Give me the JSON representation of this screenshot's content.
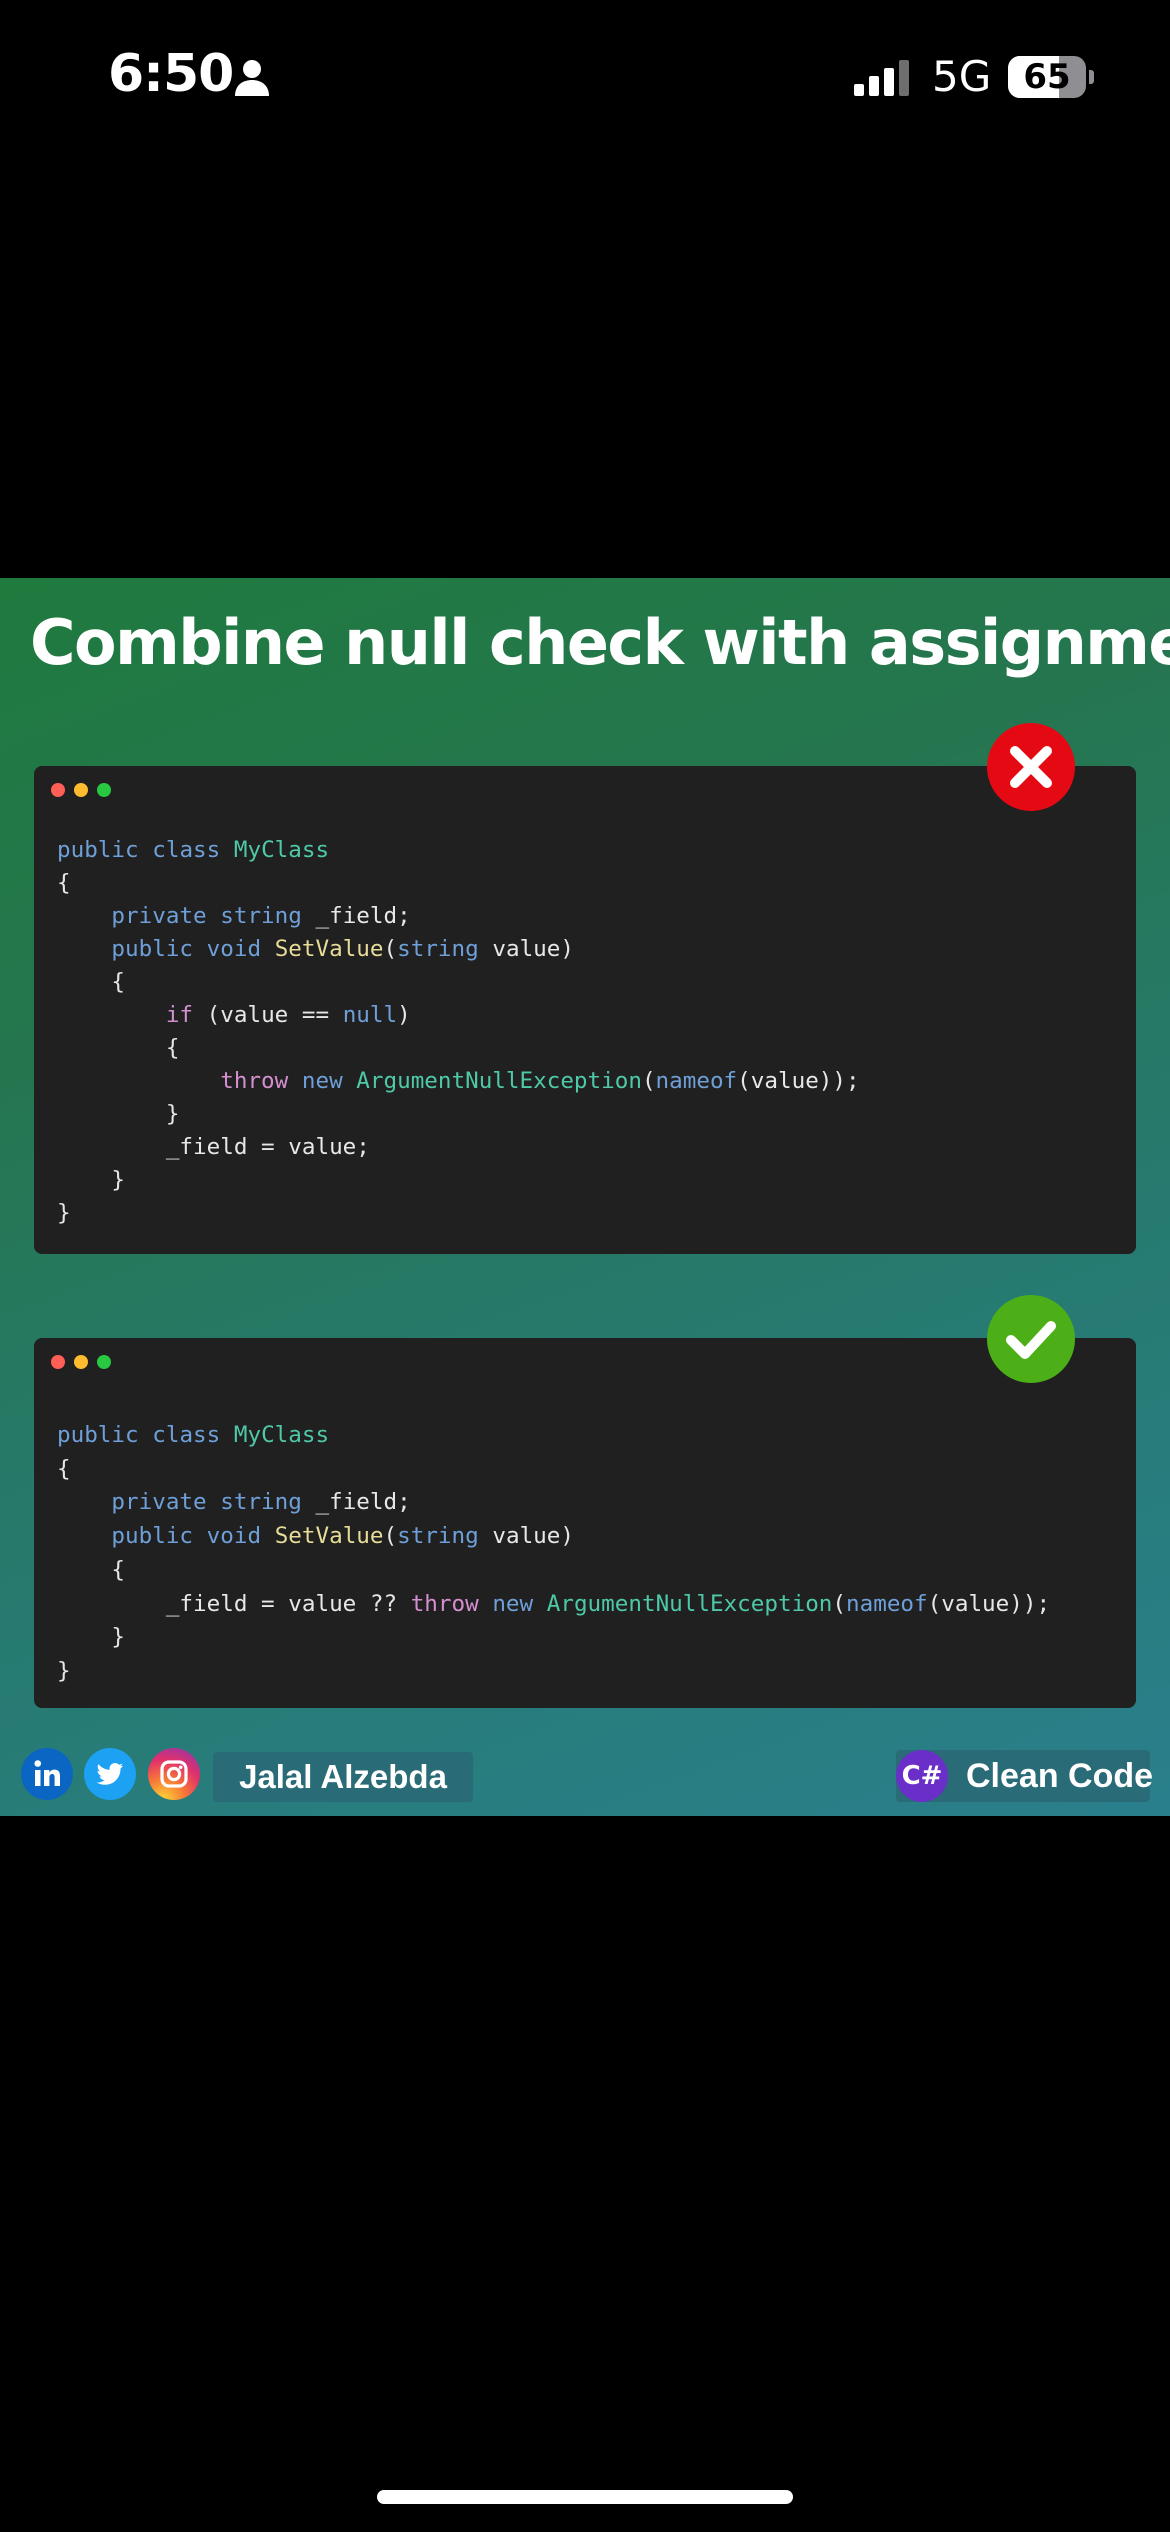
{
  "status_bar": {
    "time": "6:50",
    "network": "5G",
    "battery_percent": "65",
    "battery_level": 0.65,
    "icons": [
      "person-icon",
      "signal-icon",
      "battery-icon"
    ]
  },
  "post": {
    "title": "Combine null check with assignment",
    "bad_example": {
      "badge_icon": "x-icon",
      "badge_color": "#e50914",
      "lines": [
        [
          [
            "kw",
            "public"
          ],
          [
            "pl",
            " "
          ],
          [
            "kw",
            "class"
          ],
          [
            "pl",
            " "
          ],
          [
            "ty",
            "MyClass"
          ]
        ],
        [
          [
            "pl",
            "{"
          ]
        ],
        [
          [
            "pl",
            "    "
          ],
          [
            "kw",
            "private"
          ],
          [
            "pl",
            " "
          ],
          [
            "kw",
            "string"
          ],
          [
            "pl",
            " "
          ],
          [
            "id",
            "_field"
          ],
          [
            "pl",
            ";"
          ]
        ],
        [
          [
            "pl",
            "    "
          ],
          [
            "kw",
            "public"
          ],
          [
            "pl",
            " "
          ],
          [
            "kw",
            "void"
          ],
          [
            "pl",
            " "
          ],
          [
            "fn",
            "SetValue"
          ],
          [
            "pl",
            "("
          ],
          [
            "kw",
            "string"
          ],
          [
            "pl",
            " "
          ],
          [
            "id",
            "value"
          ],
          [
            "pl",
            ")"
          ]
        ],
        [
          [
            "pl",
            "    {"
          ]
        ],
        [
          [
            "pl",
            "        "
          ],
          [
            "ctl",
            "if"
          ],
          [
            "pl",
            " ("
          ],
          [
            "id",
            "value"
          ],
          [
            "pl",
            " == "
          ],
          [
            "kw",
            "null"
          ],
          [
            "pl",
            ")"
          ]
        ],
        [
          [
            "pl",
            "        {"
          ]
        ],
        [
          [
            "pl",
            "            "
          ],
          [
            "ctl",
            "throw"
          ],
          [
            "pl",
            " "
          ],
          [
            "kw",
            "new"
          ],
          [
            "pl",
            " "
          ],
          [
            "ty",
            "ArgumentNullException"
          ],
          [
            "pl",
            "("
          ],
          [
            "kw",
            "nameof"
          ],
          [
            "pl",
            "("
          ],
          [
            "id",
            "value"
          ],
          [
            "pl",
            "));"
          ]
        ],
        [
          [
            "pl",
            "        }"
          ]
        ],
        [
          [
            "pl",
            "        "
          ],
          [
            "id",
            "_field"
          ],
          [
            "pl",
            " = "
          ],
          [
            "id",
            "value"
          ],
          [
            "pl",
            ";"
          ]
        ],
        [
          [
            "pl",
            "    }"
          ]
        ],
        [
          [
            "pl",
            "}"
          ]
        ]
      ]
    },
    "good_example": {
      "badge_icon": "check-icon",
      "badge_color": "#4caf18",
      "lines": [
        [
          [
            "kw",
            "public"
          ],
          [
            "pl",
            " "
          ],
          [
            "kw",
            "class"
          ],
          [
            "pl",
            " "
          ],
          [
            "ty",
            "MyClass"
          ]
        ],
        [
          [
            "pl",
            "{"
          ]
        ],
        [
          [
            "pl",
            "    "
          ],
          [
            "kw",
            "private"
          ],
          [
            "pl",
            " "
          ],
          [
            "kw",
            "string"
          ],
          [
            "pl",
            " "
          ],
          [
            "id",
            "_field"
          ],
          [
            "pl",
            ";"
          ]
        ],
        [
          [
            "pl",
            "    "
          ],
          [
            "kw",
            "public"
          ],
          [
            "pl",
            " "
          ],
          [
            "kw",
            "void"
          ],
          [
            "pl",
            " "
          ],
          [
            "fn",
            "SetValue"
          ],
          [
            "pl",
            "("
          ],
          [
            "kw",
            "string"
          ],
          [
            "pl",
            " "
          ],
          [
            "id",
            "value"
          ],
          [
            "pl",
            ")"
          ]
        ],
        [
          [
            "pl",
            "    {"
          ]
        ],
        [
          [
            "pl",
            "        "
          ],
          [
            "id",
            "_field"
          ],
          [
            "pl",
            " = "
          ],
          [
            "id",
            "value"
          ],
          [
            "pl",
            " ?? "
          ],
          [
            "ctl",
            "throw"
          ],
          [
            "pl",
            " "
          ],
          [
            "kw",
            "new"
          ],
          [
            "pl",
            " "
          ],
          [
            "ty",
            "ArgumentNullException"
          ],
          [
            "pl",
            "("
          ],
          [
            "kw",
            "nameof"
          ],
          [
            "pl",
            "("
          ],
          [
            "id",
            "value"
          ],
          [
            "pl",
            "));"
          ]
        ],
        [
          [
            "pl",
            "    }"
          ]
        ],
        [
          [
            "pl",
            "}"
          ]
        ]
      ]
    },
    "footer": {
      "social_icons": [
        "linkedin-icon",
        "twitter-icon",
        "instagram-icon"
      ],
      "author": "Jalal Alzebda",
      "brand_icon_text": "C#",
      "brand": "Clean Code"
    }
  }
}
